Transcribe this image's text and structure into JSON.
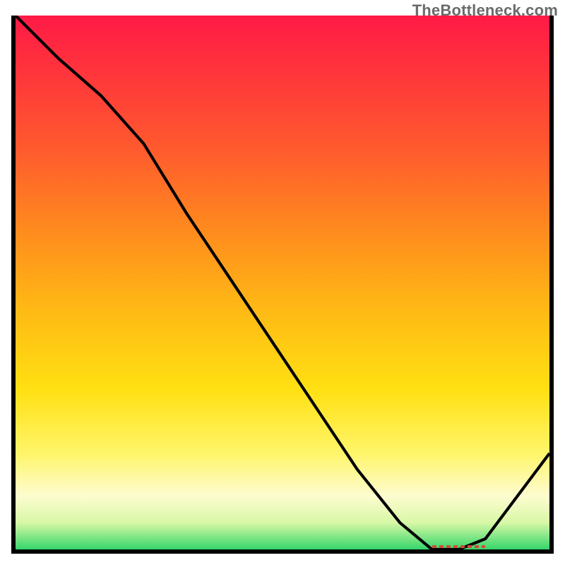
{
  "watermark": "TheBottleneck.com",
  "colors": {
    "border": "#000000",
    "curve": "#000000",
    "marker": "#d24a3a",
    "gradient_top": "#ff1a46",
    "gradient_bottom": "#34d66a"
  },
  "chart_data": {
    "type": "line",
    "title": "",
    "xlabel": "",
    "ylabel": "",
    "xlim": [
      0,
      100
    ],
    "ylim": [
      0,
      100
    ],
    "grid": false,
    "background": "vertical-gradient red→green",
    "series": [
      {
        "name": "bottleneck-curve",
        "x": [
          0,
          8,
          16,
          24,
          32,
          40,
          48,
          56,
          64,
          72,
          78,
          83,
          88,
          100
        ],
        "y": [
          100,
          92,
          85,
          76,
          63,
          51,
          39,
          27,
          15,
          5,
          0,
          0,
          2,
          18
        ]
      }
    ],
    "annotations": [
      {
        "name": "optimal-range-marker",
        "kind": "dotted-segment",
        "y": 0,
        "x_start": 78,
        "x_end": 88
      }
    ]
  }
}
